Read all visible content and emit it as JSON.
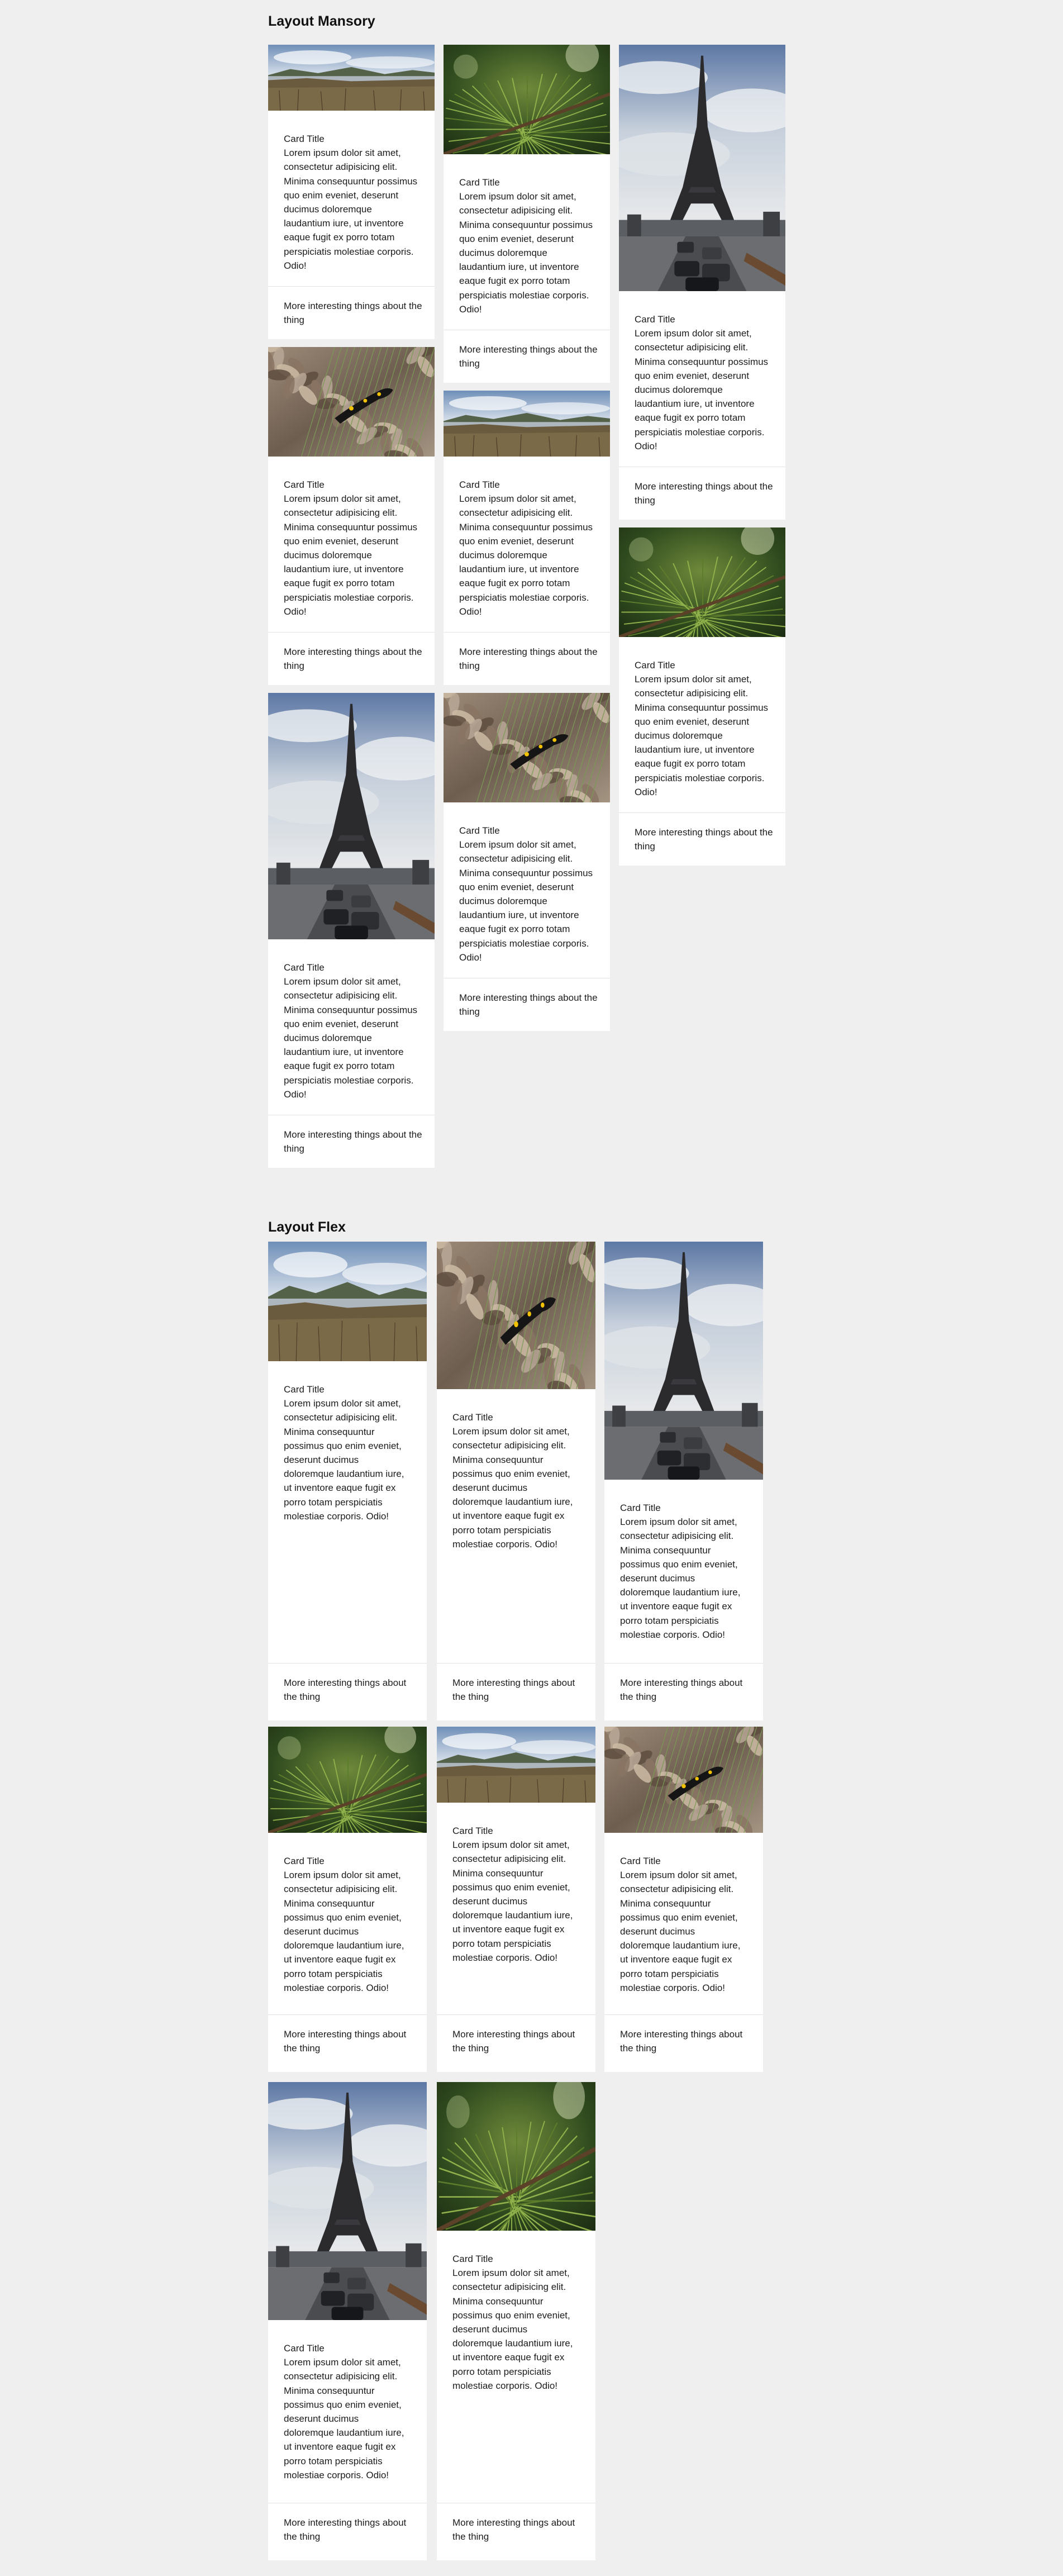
{
  "sections": {
    "masonry_title": "Layout Mansory",
    "flex_title": "Layout Flex"
  },
  "card": {
    "title": "Card Title",
    "text": "Lorem ipsum dolor sit amet, consectetur adipisicing elit. Minima consequuntur possimus quo enim eveniet, deserunt ducimus doloremque laudantium iure, ut inventore eaque fugit ex porro totam perspiciatis molestiae corporis. Odio!",
    "footer": "More interesting things about the thing"
  },
  "masonry_cards": [
    {
      "image": "lake-landscape"
    },
    {
      "image": "pine-branch"
    },
    {
      "image": "eiffel-tower"
    },
    {
      "image": "salamander-leaves"
    },
    {
      "image": "lake-landscape"
    },
    {
      "image": "pine-branch"
    },
    {
      "image": "eiffel-tower"
    },
    {
      "image": "salamander-leaves"
    }
  ],
  "flex_cards": [
    {
      "image": "lake-landscape"
    },
    {
      "image": "salamander-leaves"
    },
    {
      "image": "eiffel-tower"
    },
    {
      "image": "pine-branch"
    },
    {
      "image": "lake-landscape"
    },
    {
      "image": "salamander-leaves"
    },
    {
      "image": "eiffel-tower"
    },
    {
      "image": "pine-branch"
    }
  ]
}
